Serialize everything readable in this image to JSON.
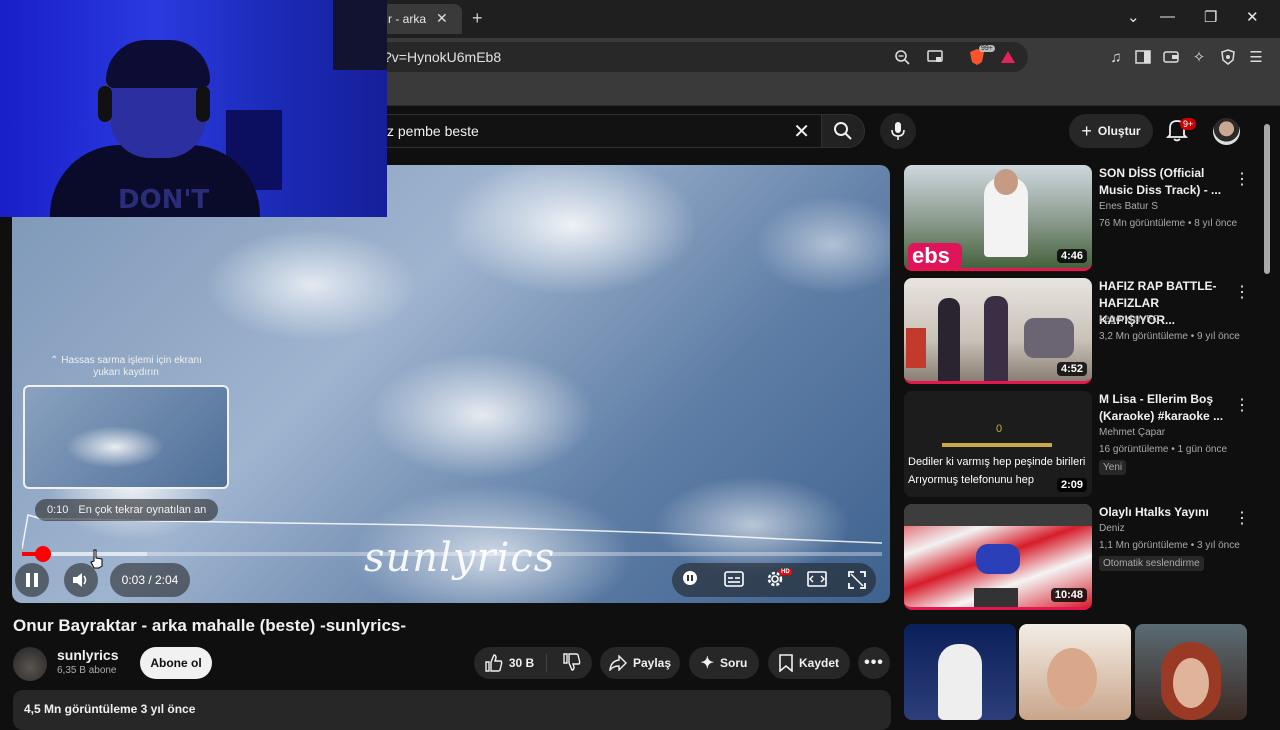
{
  "browser": {
    "tab_title": "r - arka",
    "url": "?v=HynokU6mEb8",
    "brave_badge": "99+"
  },
  "header": {
    "search_query": "z pembe beste",
    "create_label": "Oluştur",
    "notif_count": "9+"
  },
  "player": {
    "watermark": "sunlyrics",
    "scroll_hint": "⌃ Hassas sarma işlemi için ekranı yukarı kaydırın",
    "chapter_time": "0:10",
    "chapter_label": "En çok tekrar oynatılan an",
    "current_time": "0:03",
    "duration": "2:04",
    "time_display": "0:03 / 2:04",
    "progress_fraction": 0.0242,
    "buffer_fraction": 0.145,
    "hd_badge": "HD"
  },
  "video": {
    "title": "Onur Bayraktar - arka mahalle (beste) -sunlyrics-",
    "channel": "sunlyrics",
    "subscribers": "6,35 B abone",
    "subscribe_label": "Abone ol",
    "likes": "30 B",
    "share_label": "Paylaş",
    "ask_label": "Soru",
    "save_label": "Kaydet",
    "views_date": "4,5 Mn görüntüleme  3 yıl önce"
  },
  "recommendations": [
    {
      "title": "SON DİSS (Official Music Diss Track) - ...",
      "channel": "Enes Batur S",
      "meta": "76 Mn görüntüleme • 8 yıl önce",
      "duration": "4:46",
      "thumb_text": "ebs"
    },
    {
      "title": "HAFIZ RAP BATTLE-HAFIZLAR KAPIŞIYOR...",
      "channel": "LegendaryFC",
      "meta": "3,2 Mn görüntüleme • 9 yıl önce",
      "duration": "4:52"
    },
    {
      "title": "M Lisa - Ellerim Boş (Karaoke) #karaoke ...",
      "channel": "Mehmet Çapar",
      "meta": "16 görüntüleme • 1 gün önce",
      "duration": "2:09",
      "tag": "Yeni",
      "thumb_line1": "Dediler ki varmış hep peşinde birileri",
      "thumb_line2": "Arıyormuş telefonunu hep"
    },
    {
      "title": "Olaylı Htalks Yayını",
      "channel": "Deniz",
      "meta": "1,1 Mn görüntüleme • 3 yıl önce",
      "duration": "10:48",
      "tag": "Otomatik seslendirme"
    }
  ],
  "webcam": {
    "shirt_text": "DON'T"
  },
  "colors": {
    "accent_red": "#ff0000",
    "bg": "#0f0f0f",
    "pill_bg": "#272727"
  }
}
